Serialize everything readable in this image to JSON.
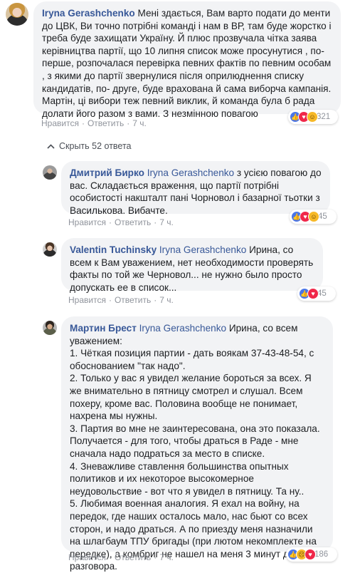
{
  "comments": [
    {
      "author": "Iryna Gerashchenko",
      "mention": "",
      "text": "Мені здається, Вам варто подати до менти до ЦВК, Ви точно потрібні команді і нам в ВР, там буде жорстко і треба буде захищати Україну. Й плюс прозвучала чітка заява керівництва партії, що 10 липня список може просунутися , по-перше, розпочалася перевірка певних фактів по певним особам , з якими до партії звернулися після оприлюднення списку кандидатів, по- друге, буде врахована й сама виборча кампанія. Мартін, ці вибори теж певний виклик, й команда була б рада долати його разом з вами. З незмінною повагою",
      "reactions": [
        "like",
        "love",
        "haha"
      ],
      "reaction_count": "321",
      "like_label": "Нравится",
      "reply_label": "Ответить",
      "time": "7 ч."
    },
    {
      "author": "Дмитрий Бирко",
      "mention": "Iryna Gerashchenko",
      "text": "з усією повагою до вас. Складається враження, що партії потрібні особистості накшталт пані Чорновол і базарної тьотки з Василькова. Вибачте.",
      "reactions": [
        "like",
        "love",
        "haha"
      ],
      "reaction_count": "45",
      "like_label": "Нравится",
      "reply_label": "Ответить",
      "time": "7 ч."
    },
    {
      "author": "Valentin Tuchinsky",
      "mention": "Iryna Gerashchenko",
      "text": "Ирина, со всем к Вам уважением, нет необходимости проверять факты по той же Черновол... не нужно было просто допускать ее в список...",
      "reactions": [
        "like",
        "love"
      ],
      "reaction_count": "45",
      "like_label": "Нравится",
      "reply_label": "Ответить",
      "time": "7 ч."
    },
    {
      "author": "Мартин Брест",
      "mention": "Iryna Gerashchenko",
      "text_lines": [
        "Ирина, со всем уважением:",
        "1. Чёткая позиция партии - дать воякам 37-43-48-54, с обоснованием \"так надо\".",
        "2. Только у вас я увидел желание бороться за всех. Я же внимательно в пятницу смотрел и слушал. Всем похеру, кроме вас. Половина вообще не понимает, нахрена мы нужны.",
        "3. Партия во мне не заинтересована, она это показала. Получается - для того, чтобы драться в Раде - мне сначала надо подраться за место в списке.",
        "4. Зневажливе ставлення большинства опытных политиков и их некоторое высокомерное неудовольствие - вот что я увидел в пятницу. Та ну..",
        "5. Любимая военная аналогия. Я ехал на войну, на передок, где наших осталось мало, нас бьют со всех сторон, и надо драться. А по приезду меня назначили на шлагбаум ТПУ бригады (при лютом некомплекте на передке), а комбриг не нашел на меня 3 минут для разговора."
      ],
      "reactions": [
        "like",
        "sad",
        "love"
      ],
      "reaction_count": "186",
      "like_label": "Нравится",
      "reply_label": "Ответить",
      "time": "7 ч."
    }
  ],
  "hide_replies_label": "Скрыть 52 ответа",
  "colors": {
    "link": "#385898",
    "bubble": "#f2f3f5",
    "muted": "#90949c",
    "like": "#4a76e8",
    "love": "#f0284a",
    "haha": "#f7b928"
  }
}
